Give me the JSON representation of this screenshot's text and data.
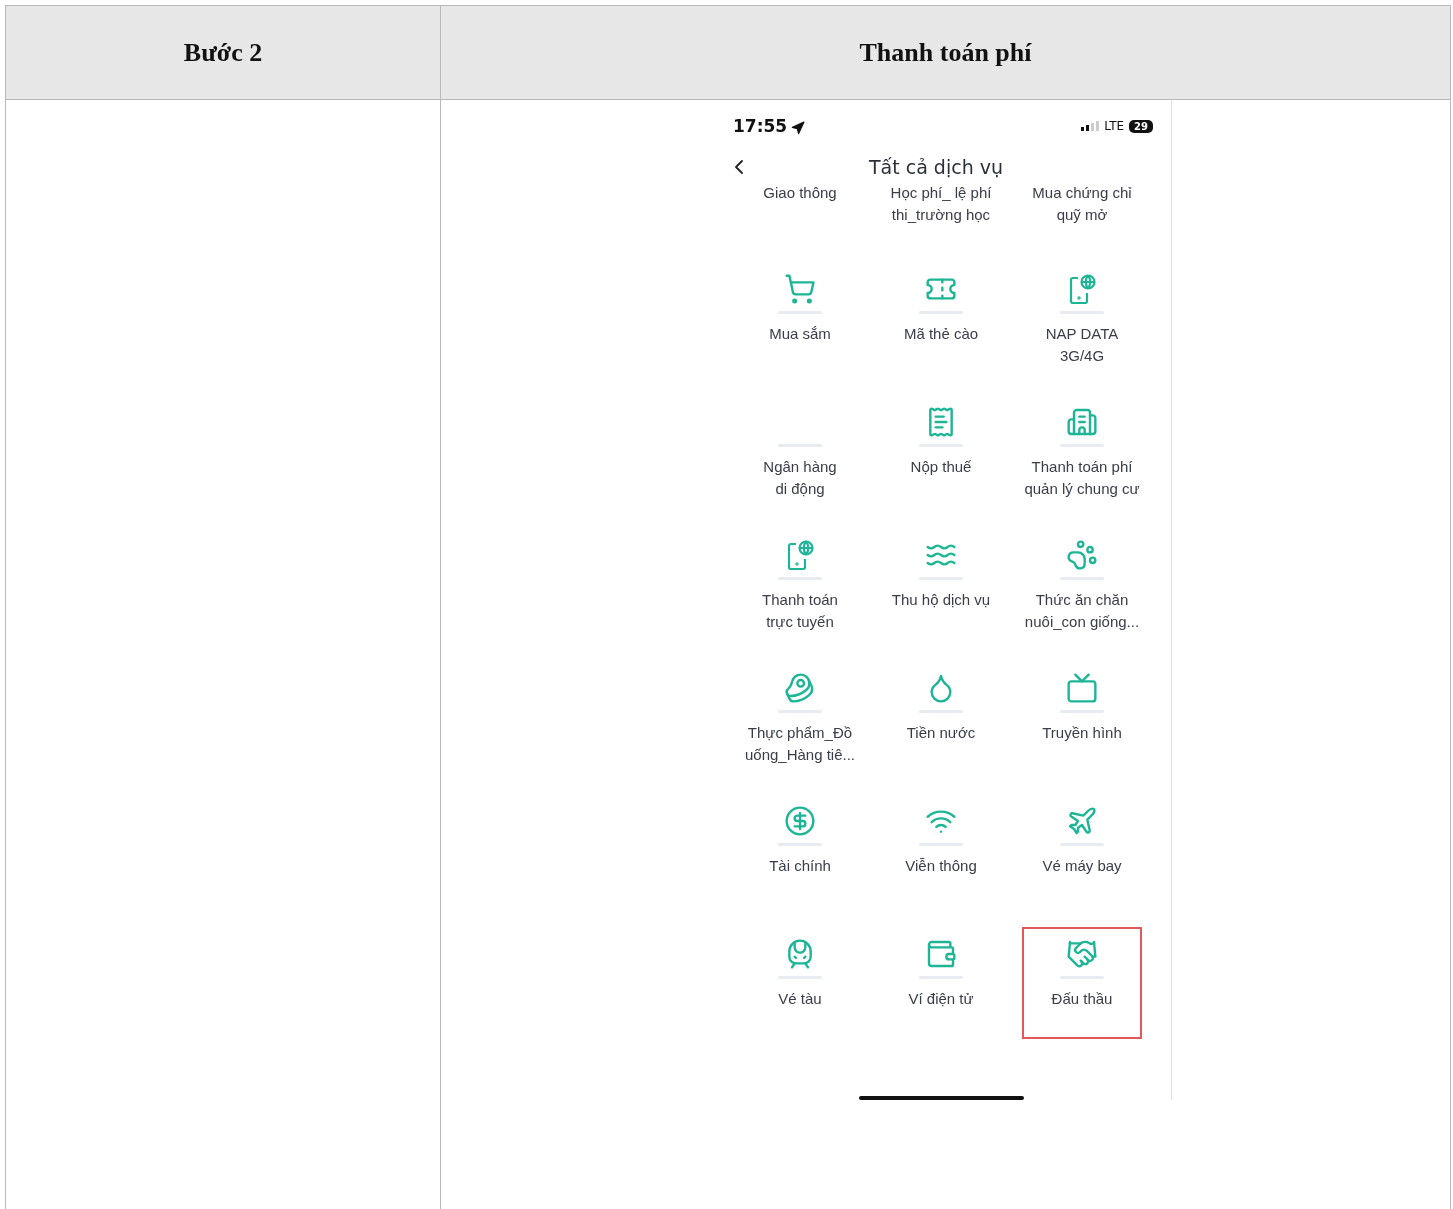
{
  "table": {
    "headers": [
      "Bước 2",
      "Thanh toán phí"
    ]
  },
  "phone": {
    "status_bar": {
      "time": "17:55",
      "network": "LTE",
      "battery": "29"
    },
    "nav": {
      "title": "Tất cả dịch vụ"
    },
    "services": [
      {
        "kind": "text-only",
        "label": [
          "Giao thông"
        ],
        "highlighted": false
      },
      {
        "kind": "text-only",
        "label": [
          "Học phí_ lệ phí",
          "thi_trường học"
        ],
        "highlighted": false
      },
      {
        "kind": "text-only",
        "label": [
          "Mua chứng chỉ",
          "quỹ mở"
        ],
        "highlighted": false
      },
      {
        "kind": "cart",
        "label": [
          "Mua sắm"
        ],
        "highlighted": false
      },
      {
        "kind": "card",
        "label": [
          "Mã thẻ cào"
        ],
        "highlighted": false
      },
      {
        "kind": "phone-globe",
        "label": [
          "NAP DATA",
          "3G/4G"
        ],
        "highlighted": false
      },
      {
        "kind": "blank",
        "label": [
          "Ngân hàng",
          "di động"
        ],
        "highlighted": false
      },
      {
        "kind": "receipt",
        "label": [
          "Nộp thuế"
        ],
        "highlighted": false
      },
      {
        "kind": "building",
        "label": [
          "Thanh toán phí",
          "quản lý chung cư"
        ],
        "highlighted": false
      },
      {
        "kind": "phone-globe",
        "label": [
          "Thanh toán",
          "trực tuyến"
        ],
        "highlighted": false
      },
      {
        "kind": "hand",
        "label": [
          "Thu hộ dịch vụ"
        ],
        "highlighted": false
      },
      {
        "kind": "paw",
        "label": [
          "Thức ăn chăn",
          "nuôi_con giống..."
        ],
        "highlighted": false
      },
      {
        "kind": "meat",
        "label": [
          "Thực phẩm_Đồ",
          "uống_Hàng tiê..."
        ],
        "highlighted": false
      },
      {
        "kind": "drop",
        "label": [
          "Tiền nước"
        ],
        "highlighted": false
      },
      {
        "kind": "tv",
        "label": [
          "Truyền hình"
        ],
        "highlighted": false
      },
      {
        "kind": "dollar",
        "label": [
          "Tài chính"
        ],
        "highlighted": false
      },
      {
        "kind": "wifi",
        "label": [
          "Viễn thông"
        ],
        "highlighted": false
      },
      {
        "kind": "plane",
        "label": [
          "Vé máy bay"
        ],
        "highlighted": false
      },
      {
        "kind": "train",
        "label": [
          "Vé tàu"
        ],
        "highlighted": false
      },
      {
        "kind": "wallet",
        "label": [
          "Ví điện tử"
        ],
        "highlighted": false
      },
      {
        "kind": "handshake",
        "label": [
          "Đấu thầu"
        ],
        "highlighted": true
      }
    ]
  }
}
